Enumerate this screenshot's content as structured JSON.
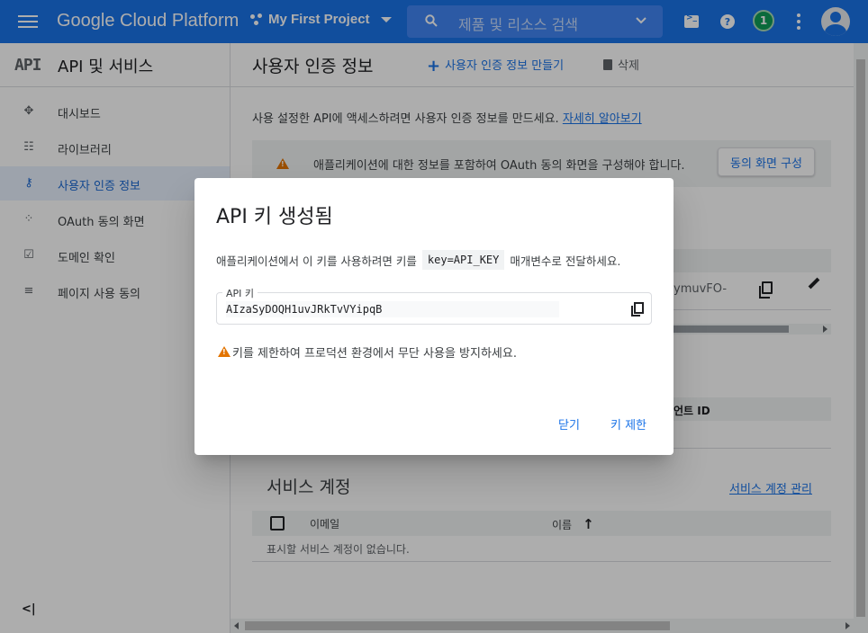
{
  "topbar": {
    "brand": "Google Cloud Platform",
    "project": "My First Project",
    "search_placeholder": "제품 및 리소스 검색",
    "notification_count": "1"
  },
  "sidebar": {
    "logo": "API",
    "title": "API 및 서비스",
    "items": [
      {
        "label": "대시보드",
        "icon": "dashboard-icon"
      },
      {
        "label": "라이브러리",
        "icon": "library-icon"
      },
      {
        "label": "사용자 인증 정보",
        "icon": "key-icon",
        "active": true
      },
      {
        "label": "OAuth 동의 화면",
        "icon": "consent-icon"
      },
      {
        "label": "도메인 확인",
        "icon": "domain-check-icon"
      },
      {
        "label": "페이지 사용 동의",
        "icon": "settings-list-icon"
      }
    ],
    "collapse_label": "<|"
  },
  "main": {
    "title": "사용자 인증 정보",
    "create_label": "사용자 인증 정보 만들기",
    "delete_label": "삭제",
    "intro": "사용 설정한 API에 액세스하려면 사용자 인증 정보를 만드세요.",
    "intro_link": "자세히 알아보기",
    "banner_text": "애플리케이션에 대한 정보를 포함하여 OAuth 동의 화면을 구성해야 합니다.",
    "banner_button": "동의 화면 구성",
    "key_tail": "ymuvFO-",
    "client_id_header": "언트 ID",
    "service_accounts": {
      "title": "서비스 계정",
      "manage_link": "서비스 계정 관리",
      "col_email": "이메일",
      "col_name": "이름",
      "empty": "표시할 서비스 계정이 없습니다."
    }
  },
  "dialog": {
    "title": "API 키 생성됨",
    "desc_before": "애플리케이션에서 이 키를 사용하려면 키를",
    "desc_code": "key=API_KEY",
    "desc_after": "매개변수로 전달하세요.",
    "key_label": "API 키",
    "key_value": "AIzaSyDOQH1uvJRkTvVYipqB",
    "warning": "키를 제한하여 프로덕션 환경에서 무단 사용을 방지하세요.",
    "close_button": "닫기",
    "restrict_button": "키 제한"
  },
  "colors": {
    "brand_blue": "#1a73e8",
    "warning_orange": "#e37400",
    "notification_green": "#0f9d58"
  }
}
